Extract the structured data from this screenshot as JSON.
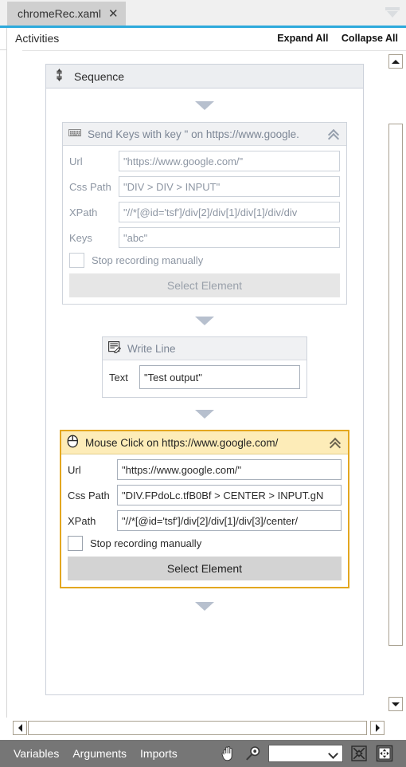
{
  "window": {
    "tab": {
      "label": "chromeRec.xaml",
      "close_icon": "close-icon"
    },
    "tab_overflow_icon": "tab-overflow-icon"
  },
  "header": {
    "title": "Activities",
    "expand_all": "Expand All",
    "collapse_all": "Collapse All"
  },
  "sequence": {
    "icon": "sequence-icon",
    "name": "Sequence"
  },
  "activities": [
    {
      "id": "send-keys",
      "icon": "keyboard-icon",
      "title": "Send Keys with key \" on https://www.google.",
      "selected": false,
      "collapse_icon": "chevron-up-icon",
      "fields": [
        {
          "label": "Url",
          "value": "\"https://www.google.com/\""
        },
        {
          "label": "Css Path",
          "value": "\"DIV > DIV > INPUT\""
        },
        {
          "label": "XPath",
          "value": "\"//*[@id='tsf']/div[2]/div[1]/div[1]/div/div"
        },
        {
          "label": "Keys",
          "value": "\"abc\""
        }
      ],
      "checkbox": {
        "label": "Stop recording manually",
        "checked": false
      },
      "button": "Select Element"
    },
    {
      "id": "write-line",
      "icon": "write-line-icon",
      "title": "Write Line",
      "selected": false,
      "fields": [
        {
          "label": "Text",
          "value": "\"Test output\""
        }
      ]
    },
    {
      "id": "mouse-click",
      "icon": "mouse-icon",
      "title": "Mouse Click on https://www.google.com/",
      "selected": true,
      "collapse_icon": "chevron-up-icon",
      "fields": [
        {
          "label": "Url",
          "value": "\"https://www.google.com/\""
        },
        {
          "label": "Css Path",
          "value": "\"DIV.FPdoLc.tfB0Bf > CENTER > INPUT.gN"
        },
        {
          "label": "XPath",
          "value": "\"//*[@id='tsf']/div[2]/div[1]/div[3]/center/"
        }
      ],
      "checkbox": {
        "label": "Stop recording manually",
        "checked": false
      },
      "button": "Select Element"
    }
  ],
  "scrollbars": {
    "v_up_icon": "scroll-up-icon",
    "v_down_icon": "scroll-down-icon",
    "h_left_icon": "scroll-left-icon",
    "h_right_icon": "scroll-right-icon"
  },
  "statusbar": {
    "variables": "Variables",
    "arguments": "Arguments",
    "imports": "Imports",
    "pan_icon": "hand-pan-icon",
    "zoom_icon": "magnifier-zoom-icon",
    "zoom_value": "",
    "fit_to_screen_icon": "fit-to-screen-icon",
    "overview_icon": "overview-icon"
  },
  "colors": {
    "accent": "#2eaadc",
    "selection": "#e3a720",
    "selection_header": "#fdecb8",
    "statusbar": "#767676"
  }
}
